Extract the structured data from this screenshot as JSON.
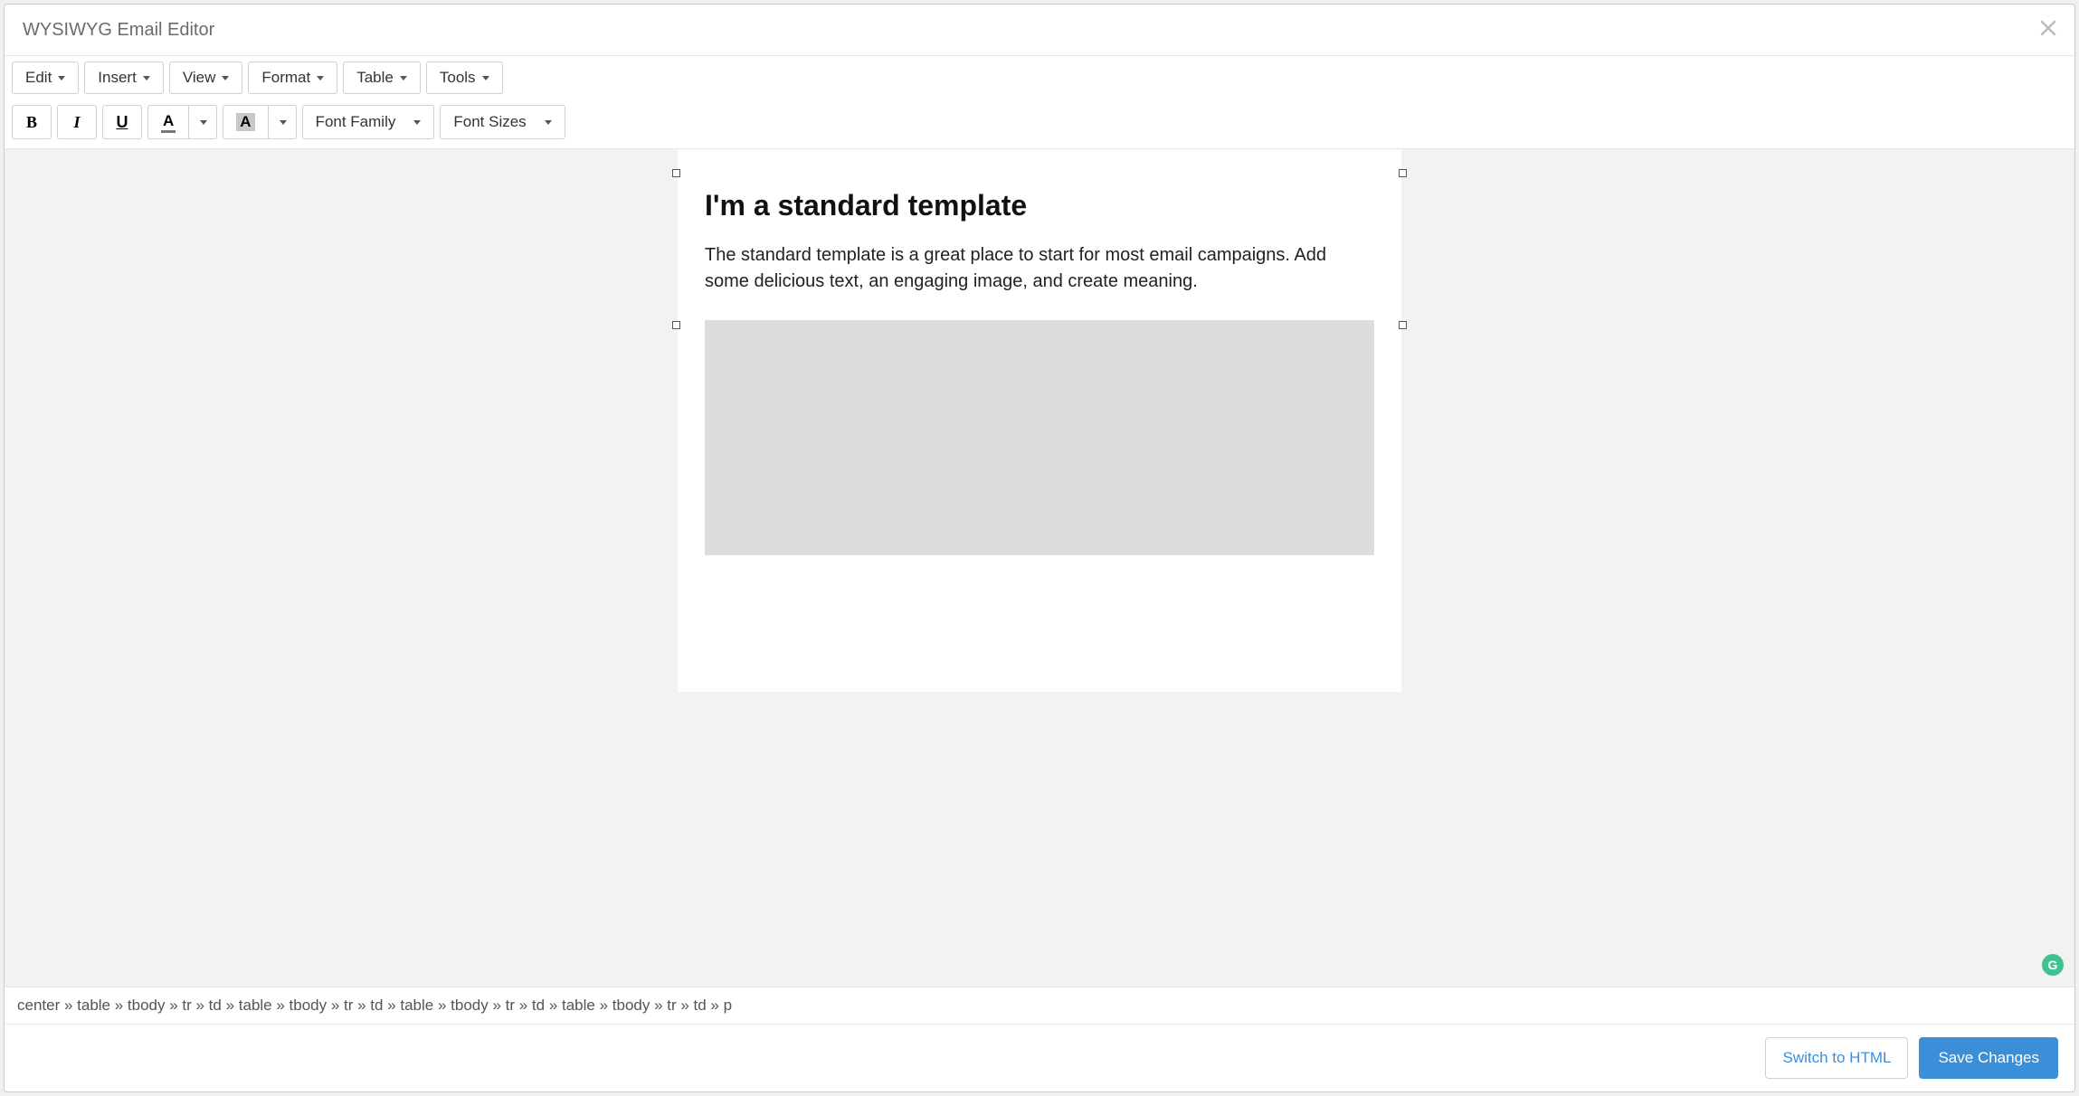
{
  "header": {
    "title": "WYSIWYG Email Editor"
  },
  "menubar": {
    "edit": "Edit",
    "insert": "Insert",
    "view": "View",
    "format": "Format",
    "table": "Table",
    "tools": "Tools"
  },
  "formatbar": {
    "bold_glyph": "B",
    "italic_glyph": "I",
    "underline_glyph": "U",
    "textcolor_glyph": "A",
    "bgcolor_glyph": "A",
    "font_family_label": "Font Family",
    "font_sizes_label": "Font Sizes"
  },
  "document": {
    "heading": "I'm a standard template",
    "paragraph": "The standard template is a great place to start for most email campaigns. Add some delicious text, an engaging image, and create meaning."
  },
  "statusbar": {
    "path": "center » table » tbody » tr » td » table » tbody » tr » td » table » tbody » tr » td » table » tbody » tr » td » p"
  },
  "footer": {
    "switch_html_label": "Switch to HTML",
    "save_label": "Save Changes"
  },
  "grammarly": {
    "glyph": "G"
  }
}
